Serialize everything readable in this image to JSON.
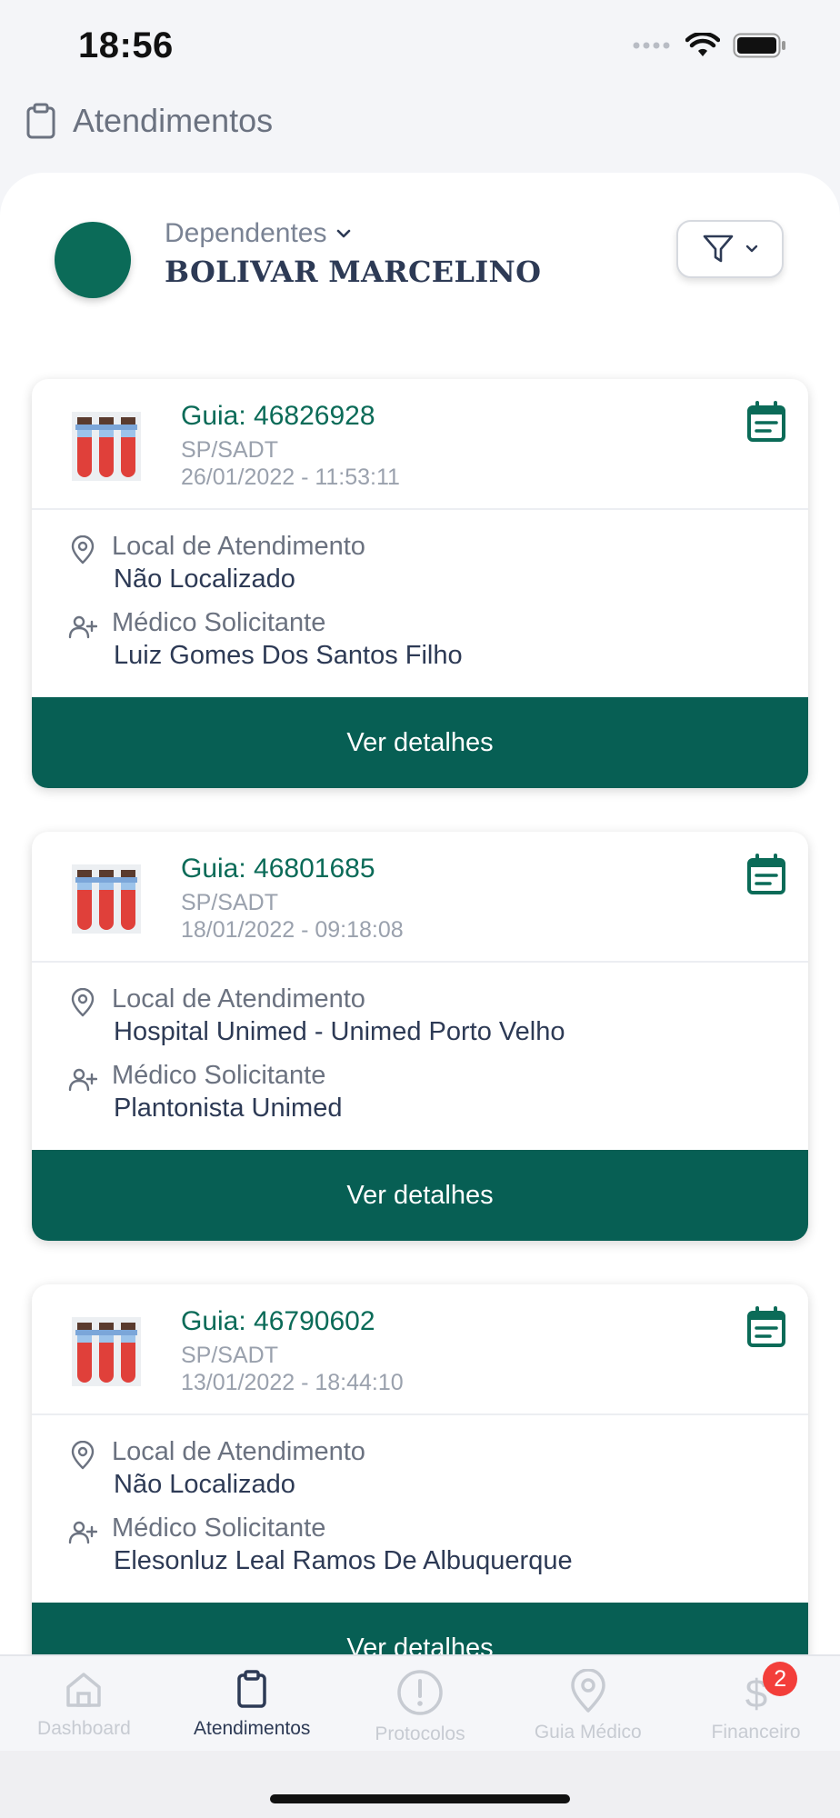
{
  "status_bar": {
    "time": "18:56"
  },
  "header": {
    "title": "Atendimentos"
  },
  "profile": {
    "dependents_label": "Dependentes",
    "member_name": "BOLIVAR MARCELINO"
  },
  "cards": [
    {
      "guia": "Guia: 46826928",
      "type": "SP/SADT",
      "datetime": "26/01/2022 - 11:53:11",
      "location_label": "Local de Atendimento",
      "location_value": "Não Localizado",
      "doctor_label": "Médico Solicitante",
      "doctor_value": "Luiz Gomes Dos Santos Filho",
      "button": "Ver detalhes"
    },
    {
      "guia": "Guia: 46801685",
      "type": "SP/SADT",
      "datetime": "18/01/2022 - 09:18:08",
      "location_label": "Local de Atendimento",
      "location_value": "Hospital Unimed - Unimed Porto Velho",
      "doctor_label": "Médico Solicitante",
      "doctor_value": "Plantonista Unimed",
      "button": "Ver detalhes"
    },
    {
      "guia": "Guia: 46790602",
      "type": "SP/SADT",
      "datetime": "13/01/2022 - 18:44:10",
      "location_label": "Local de Atendimento",
      "location_value": "Não Localizado",
      "doctor_label": "Médico Solicitante",
      "doctor_value": "Elesonluz Leal Ramos De Albuquerque",
      "button": "Ver detalhes"
    }
  ],
  "tab_bar": {
    "items": [
      {
        "label": "Dashboard",
        "icon": "home-icon",
        "active": false
      },
      {
        "label": "Atendimentos",
        "icon": "clipboard-icon",
        "active": true
      },
      {
        "label": "Protocolos",
        "icon": "alert-circle-icon",
        "active": false
      },
      {
        "label": "Guia Médico",
        "icon": "map-pin-icon",
        "active": false
      },
      {
        "label": "Financeiro",
        "icon": "dollar-icon",
        "active": false,
        "badge": "2"
      }
    ]
  },
  "colors": {
    "brand_green": "#075f54",
    "guia_green": "#0b6b58",
    "badge_red": "#f33e3a"
  }
}
